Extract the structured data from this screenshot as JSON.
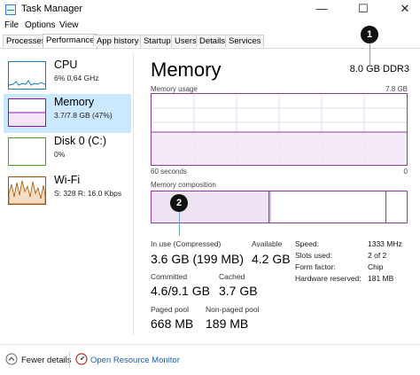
{
  "window": {
    "title": "Task Manager",
    "minimize": "—",
    "maximize": "☐",
    "close": "✕"
  },
  "menu": [
    "File",
    "Options",
    "View"
  ],
  "tabs": [
    "Processes",
    "Performance",
    "App history",
    "Startup",
    "Users",
    "Details",
    "Services"
  ],
  "sidebar": {
    "items": [
      {
        "name": "CPU",
        "sub": "6% 0.64 GHz",
        "color": "#117dbb"
      },
      {
        "name": "Memory",
        "sub": "3.7/7.8 GB (47%)",
        "color": "#8b12ae"
      },
      {
        "name": "Disk 0 (C:)",
        "sub": "0%",
        "color": "#4da60c"
      },
      {
        "name": "Wi-Fi",
        "sub": "S: 328 R: 16.0 Kbps",
        "color": "#a74f01"
      }
    ]
  },
  "main": {
    "title": "Memory",
    "spec": "8.0 GB DDR3",
    "usage_label": "Memory usage",
    "usage_max": "7.8 GB",
    "time_label": "60 seconds",
    "min_label": "0",
    "composition_label": "Memory composition",
    "accent": "#8b3ea6"
  },
  "stats": {
    "in_use_label": "In use (Compressed)",
    "in_use_value": "3.6 GB (199 MB)",
    "available_label": "Available",
    "available_value": "4.2 GB",
    "committed_label": "Committed",
    "committed_value": "4.6/9.1 GB",
    "cached_label": "Cached",
    "cached_value": "3.7 GB",
    "paged_label": "Paged pool",
    "paged_value": "668 MB",
    "nonpaged_label": "Non-paged pool",
    "nonpaged_value": "189 MB"
  },
  "details": [
    {
      "label": "Speed:",
      "value": "1333 MHz"
    },
    {
      "label": "Slots used:",
      "value": "2 of 2"
    },
    {
      "label": "Form factor:",
      "value": "Chip"
    },
    {
      "label": "Hardware reserved:",
      "value": "181 MB"
    }
  ],
  "callouts": [
    "1",
    "2"
  ],
  "footer": {
    "fewer_details": "Fewer details",
    "resource_monitor": "Open Resource Monitor"
  }
}
